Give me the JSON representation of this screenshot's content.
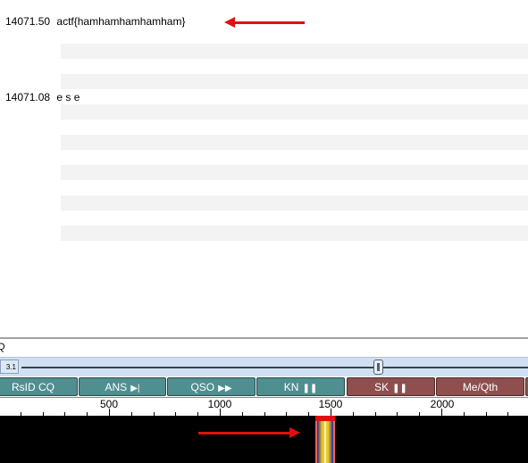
{
  "receive": {
    "lines": [
      {
        "freq": "14071.50",
        "text": "actf{hamhamhamhamham}"
      },
      {
        "freq": "14071.08",
        "text": "e s e"
      }
    ]
  },
  "transmit": {
    "text": "Q"
  },
  "slider": {
    "label": "3.1"
  },
  "macros": [
    {
      "label": "RsID CQ",
      "symbol": "",
      "color": "teal"
    },
    {
      "label": "ANS",
      "symbol": "▶|",
      "color": "teal"
    },
    {
      "label": "QSO",
      "symbol": "▶▶",
      "color": "teal"
    },
    {
      "label": "KN",
      "symbol": "❚❚",
      "color": "teal"
    },
    {
      "label": "SK",
      "symbol": "❚❚",
      "color": "maroon"
    },
    {
      "label": "Me/Qth",
      "symbol": "",
      "color": "maroon"
    }
  ],
  "scale": {
    "labels": [
      "500",
      "1000",
      "1500",
      "2000"
    ]
  },
  "colors": {
    "annotation_arrow": "#e01010",
    "macro_teal": "#4f8f8f",
    "macro_maroon": "#8f4f4f",
    "waterfall_bg": "#000000"
  }
}
